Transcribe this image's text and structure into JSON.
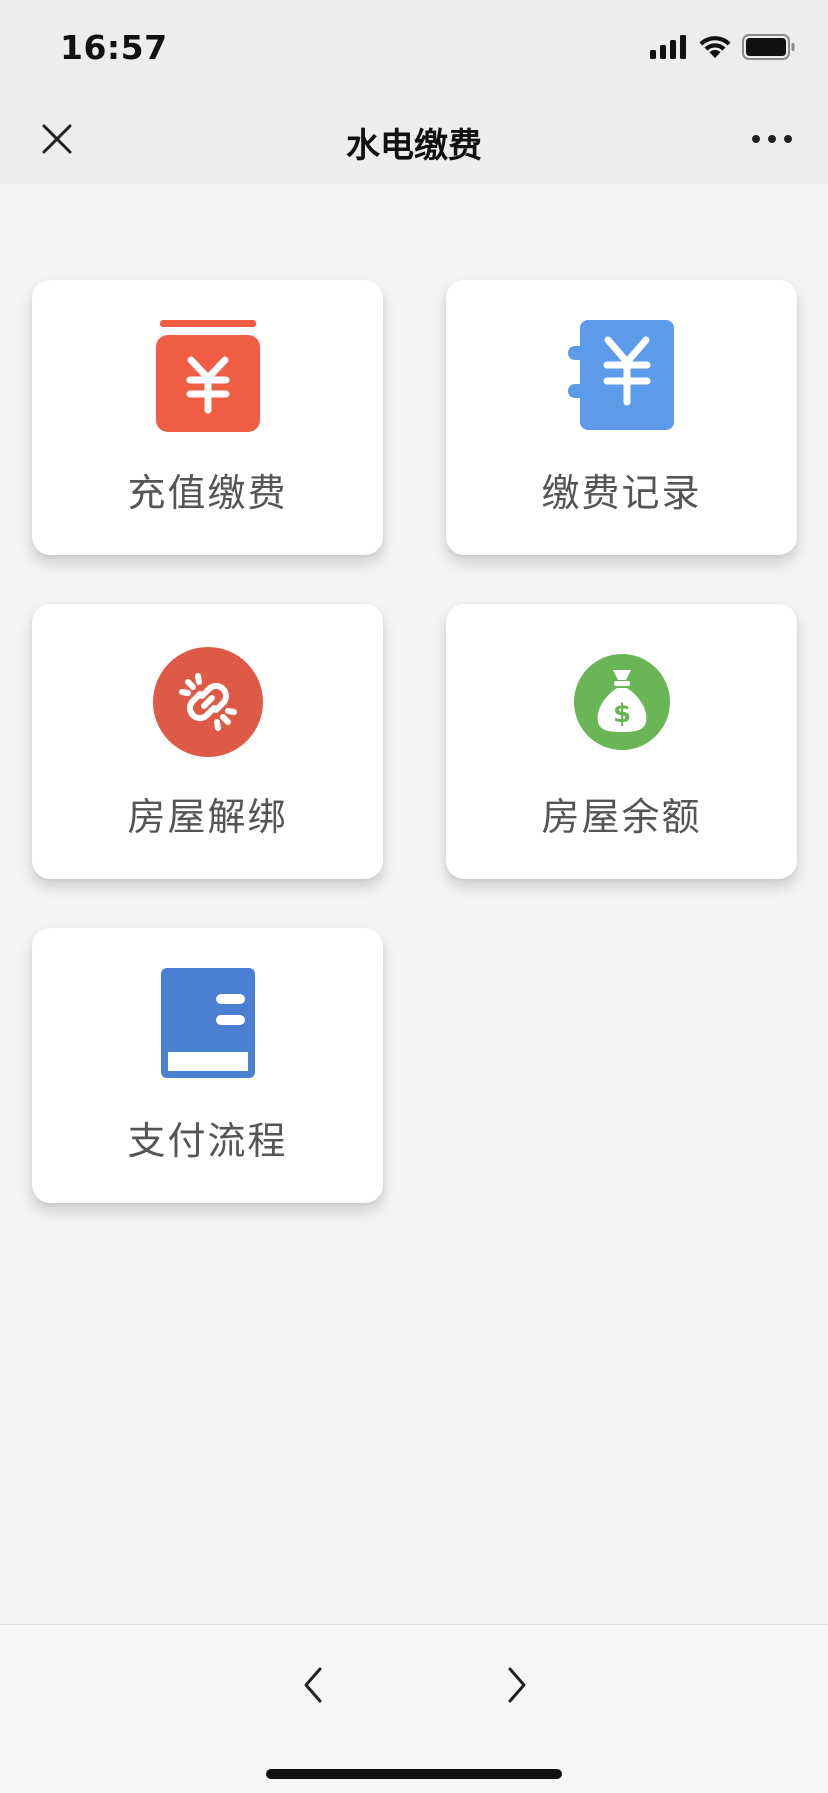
{
  "status_bar": {
    "time": "16:57",
    "icons": [
      "signal-icon",
      "wifi-icon",
      "battery-icon"
    ]
  },
  "nav": {
    "title": "水电缴费",
    "close_icon": "close-icon",
    "more_icon": "more-icon"
  },
  "cards": [
    {
      "label": "充值缴费",
      "icon": "recharge-yen-icon",
      "color": "#ef5d45"
    },
    {
      "label": "缴费记录",
      "icon": "payment-record-icon",
      "color": "#5b9be9"
    },
    {
      "label": "房屋解绑",
      "icon": "unlink-icon",
      "color": "#de5a47"
    },
    {
      "label": "房屋余额",
      "icon": "money-bag-icon",
      "color": "#6ab556"
    },
    {
      "label": "支付流程",
      "icon": "book-icon",
      "color": "#4a7fd4"
    }
  ],
  "bottom_nav": {
    "back_icon": "chevron-left-icon",
    "forward_icon": "chevron-right-icon"
  }
}
